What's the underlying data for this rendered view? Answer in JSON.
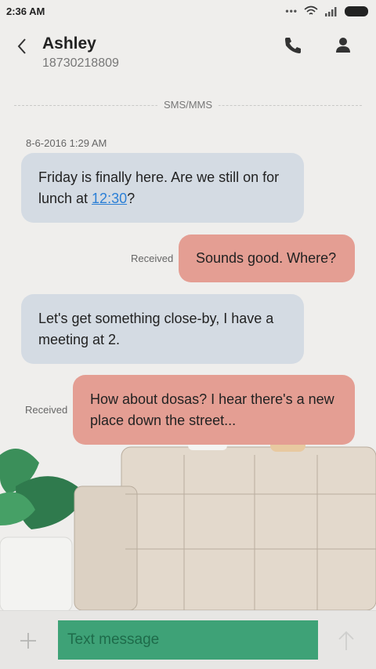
{
  "status_bar": {
    "time": "2:36 AM",
    "icons": [
      "more-dots-icon",
      "wifi-icon",
      "signal-icon",
      "battery-icon"
    ]
  },
  "header": {
    "contact_name": "Ashley",
    "contact_number": "18730218809",
    "icons": [
      "back-arrow-icon",
      "phone-icon",
      "person-icon"
    ]
  },
  "conversation": {
    "channel_label": "SMS/MMS",
    "timestamp": "8-6-2016 1:29 AM",
    "messages": [
      {
        "direction": "incoming",
        "text_before_link": "Friday is finally here. Are we still on for lunch at ",
        "link": "12:30",
        "text_after_link": "?"
      },
      {
        "direction": "outgoing",
        "status": "Received",
        "text": "Sounds good. Where?"
      },
      {
        "direction": "incoming",
        "text": "Let's get something close-by, I have a meeting at 2."
      },
      {
        "direction": "outgoing",
        "status": "Received",
        "text": "How about dosas? I hear there's a new place down the street..."
      }
    ]
  },
  "composer": {
    "placeholder": "Text message",
    "icons": [
      "add-icon",
      "send-arrow-icon"
    ]
  },
  "colors": {
    "incoming_bubble": "#d4dbe3",
    "outgoing_bubble": "#e49e93",
    "input_field": "#3ea277",
    "link": "#2b7fd6"
  }
}
